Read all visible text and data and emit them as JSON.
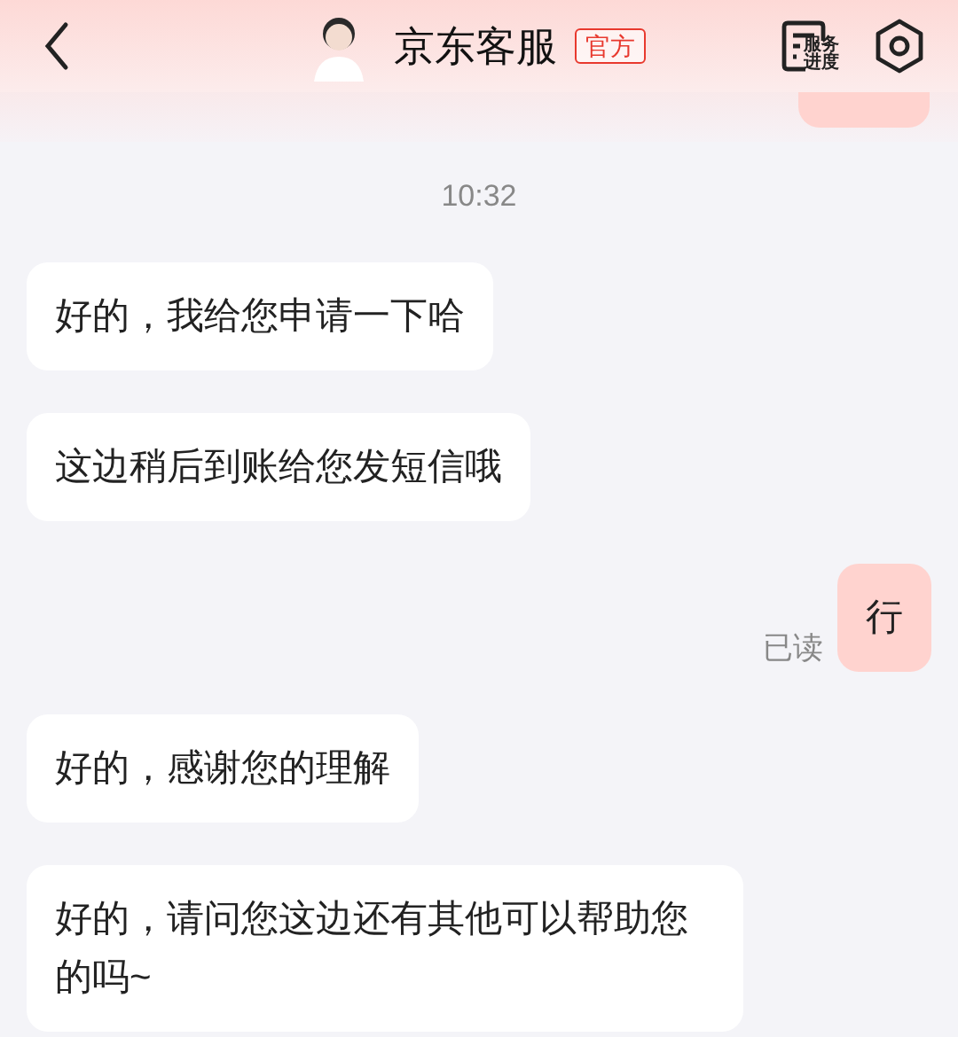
{
  "header": {
    "title": "京东客服",
    "badge": "官方",
    "service_label": [
      "服务",
      "进度"
    ]
  },
  "timestamp": "10:32",
  "messages": [
    {
      "kind": "incoming",
      "text": "好的，我给您申请一下哈"
    },
    {
      "kind": "incoming",
      "text": "这边稍后到账给您发短信哦"
    },
    {
      "kind": "outgoing",
      "text": "行",
      "read_label": "已读"
    },
    {
      "kind": "incoming",
      "text": "好的，感谢您的理解"
    },
    {
      "kind": "incoming",
      "text": "好的，请问您这边还有其他可以帮助您的吗~"
    }
  ]
}
